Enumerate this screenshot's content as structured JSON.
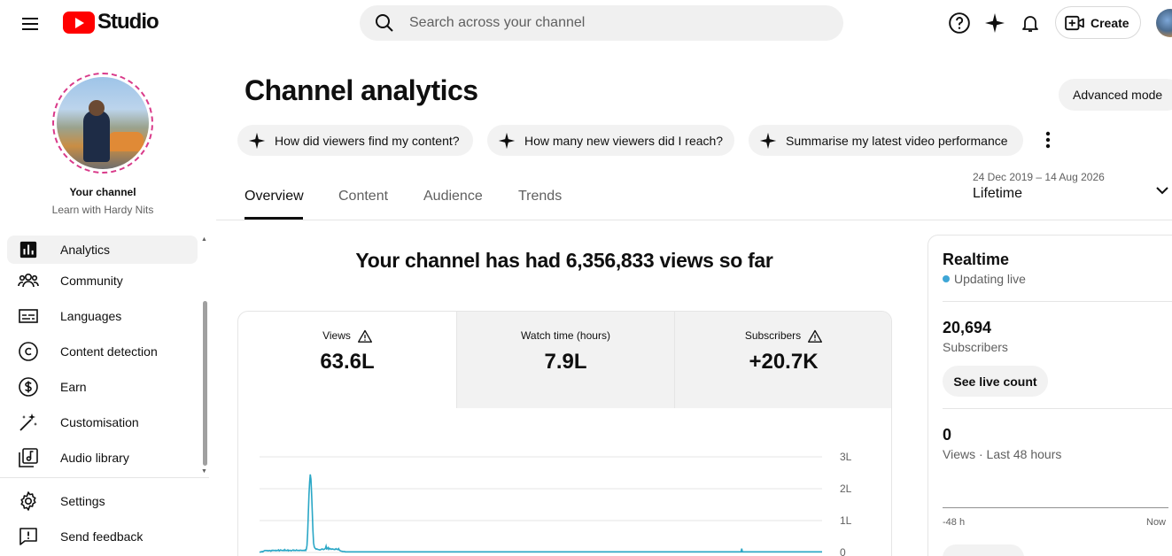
{
  "header": {
    "logo_text": "Studio",
    "search_placeholder": "Search across your channel",
    "create_label": "Create"
  },
  "sidebar": {
    "your_channel": "Your channel",
    "channel_name": "Learn with Hardy Nits",
    "items": [
      {
        "label": "Analytics",
        "icon": "analytics-icon",
        "active": true
      },
      {
        "label": "Community",
        "icon": "community-icon"
      },
      {
        "label": "Languages",
        "icon": "subtitles-icon"
      },
      {
        "label": "Content detection",
        "icon": "copyright-icon"
      },
      {
        "label": "Earn",
        "icon": "dollar-icon"
      },
      {
        "label": "Customisation",
        "icon": "magic-wand-icon"
      },
      {
        "label": "Audio library",
        "icon": "audio-library-icon"
      }
    ],
    "footer_items": [
      {
        "label": "Settings",
        "icon": "gear-icon"
      },
      {
        "label": "Send feedback",
        "icon": "feedback-icon"
      }
    ]
  },
  "main": {
    "title": "Channel analytics",
    "advanced_mode": "Advanced mode",
    "chips": [
      "How did viewers find my content?",
      "How many new viewers did I reach?",
      "Summarise my latest video performance"
    ],
    "tabs": [
      "Overview",
      "Content",
      "Audience",
      "Trends"
    ],
    "active_tab": "Overview",
    "date_range": "24 Dec 2019 – 14 Aug 2026",
    "date_label": "Lifetime",
    "headline": "Your channel has had 6,356,833 views so far",
    "metrics": [
      {
        "label": "Views",
        "value": "63.6L",
        "warning": true
      },
      {
        "label": "Watch time (hours)",
        "value": "7.9L",
        "warning": false
      },
      {
        "label": "Subscribers",
        "value": "+20.7K",
        "warning": true
      }
    ]
  },
  "chart_data": {
    "type": "line",
    "series": [
      {
        "values": [
          0.02,
          0.01,
          0.02,
          0.02,
          0.03,
          0.02,
          0.04,
          0.05,
          0.06,
          0.06,
          0.06,
          0.06,
          0.05,
          0.06,
          0.05,
          0.06,
          0.06,
          0.04,
          0.05,
          0.07,
          0.06,
          0.07,
          0.06,
          0.06,
          0.07,
          0.05,
          0.06,
          0.07,
          0.06,
          0.08,
          0.05,
          0.06,
          0.08,
          0.07,
          0.06,
          0.06,
          0.07,
          0.06,
          0.09,
          0.06,
          0.07,
          0.06,
          0.06,
          0.08,
          0.05,
          0.06,
          0.07,
          0.06,
          0.05,
          0.06,
          0.07,
          0.08,
          0.06,
          0.07,
          0.06,
          0.06,
          0.08,
          0.07,
          0.06,
          0.06,
          0.07,
          0.06,
          0.07,
          0.07,
          0.06,
          0.06,
          0.07,
          0.06,
          0.06,
          0.08,
          0.06,
          0.1,
          0.22,
          0.6,
          1.2,
          1.8,
          2.2,
          2.45,
          2.3,
          1.85,
          1.3,
          0.7,
          0.3,
          0.18,
          0.14,
          0.12,
          0.1,
          0.11,
          0.1,
          0.09,
          0.09,
          0.08,
          0.08,
          0.09,
          0.1,
          0.11,
          0.1,
          0.09,
          0.1,
          0.11,
          0.13,
          0.2,
          0.11,
          0.12,
          0.15,
          0.1,
          0.13,
          0.12,
          0.1,
          0.11,
          0.1,
          0.11,
          0.1,
          0.1,
          0.09,
          0.1,
          0.12,
          0.1,
          0.1,
          0.09,
          0.12,
          0.08,
          0.06,
          0.05,
          0.04,
          0.04,
          0.03,
          0.03,
          0.03,
          0.03,
          0.02,
          0.02,
          0.02,
          0.02,
          0.02,
          0.02,
          0.02,
          0.02,
          0.02,
          0.02,
          0.02,
          0.02,
          0.02,
          0.02,
          0.02,
          0.02,
          0.02,
          0.02,
          0.02,
          0.02,
          0.02,
          0.02,
          0.02,
          0.02,
          0.02,
          0.02,
          0.02,
          0.02,
          0.02,
          0.02,
          0.02,
          0.02,
          0.02,
          0.02,
          0.02,
          0.02,
          0.02,
          0.02,
          0.02,
          0.02,
          0.02,
          0.02,
          0.02,
          0.02,
          0.02,
          0.02,
          0.02,
          0.02,
          0.02,
          0.02,
          0.02,
          0.02,
          0.02,
          0.02,
          0.02,
          0.02,
          0.02,
          0.02,
          0.02,
          0.02,
          0.02,
          0.02,
          0.02,
          0.02,
          0.02,
          0.02,
          0.02,
          0.02,
          0.02,
          0.02,
          0.02,
          0.02,
          0.02,
          0.02,
          0.02,
          0.02,
          0.02,
          0.02,
          0.02,
          0.02,
          0.02,
          0.02,
          0.02,
          0.02,
          0.02,
          0.02,
          0.02,
          0.02,
          0.02,
          0.02,
          0.02,
          0.02,
          0.02,
          0.02,
          0.02,
          0.02,
          0.02,
          0.02,
          0.02,
          0.02,
          0.02,
          0.02,
          0.02,
          0.02,
          0.02,
          0.02,
          0.02,
          0.02,
          0.02,
          0.02,
          0.02,
          0.02,
          0.02,
          0.02,
          0.02,
          0.02,
          0.02,
          0.02,
          0.02,
          0.02,
          0.02,
          0.02,
          0.02,
          0.02,
          0.02,
          0.02,
          0.02,
          0.02,
          0.02,
          0.02,
          0.02,
          0.02,
          0.02,
          0.02,
          0.02,
          0.02,
          0.02,
          0.02,
          0.02,
          0.02,
          0.02,
          0.02,
          0.02,
          0.02,
          0.02,
          0.02,
          0.02,
          0.02,
          0.02,
          0.02,
          0.02,
          0.02,
          0.02,
          0.02,
          0.02,
          0.02,
          0.02,
          0.02,
          0.02,
          0.02,
          0.02,
          0.02,
          0.02,
          0.02,
          0.02,
          0.02,
          0.02,
          0.02,
          0.02,
          0.02,
          0.02,
          0.02,
          0.02,
          0.02,
          0.02,
          0.02,
          0.02,
          0.02,
          0.02,
          0.02,
          0.02,
          0.02,
          0.02,
          0.02,
          0.02,
          0.02,
          0.02,
          0.02,
          0.02,
          0.02,
          0.02,
          0.02,
          0.02,
          0.02,
          0.02,
          0.02,
          0.02,
          0.02,
          0.02,
          0.02,
          0.02,
          0.02,
          0.02,
          0.02,
          0.02,
          0.02,
          0.02,
          0.02,
          0.02,
          0.02,
          0.02,
          0.02,
          0.02,
          0.02,
          0.02,
          0.02,
          0.02,
          0.02,
          0.02,
          0.02,
          0.02,
          0.02,
          0.02,
          0.02,
          0.02,
          0.02,
          0.02,
          0.02,
          0.02,
          0.02,
          0.02,
          0.02,
          0.02,
          0.02,
          0.02,
          0.02,
          0.02,
          0.02,
          0.02,
          0.02,
          0.02,
          0.02,
          0.02,
          0.02,
          0.02,
          0.02,
          0.02,
          0.02,
          0.02,
          0.02,
          0.02,
          0.02,
          0.02,
          0.02,
          0.02,
          0.02,
          0.02,
          0.02,
          0.02,
          0.02,
          0.02,
          0.02,
          0.02,
          0.02,
          0.02,
          0.02,
          0.02,
          0.02,
          0.02,
          0.02,
          0.02,
          0.02,
          0.02,
          0.02,
          0.02,
          0.02,
          0.02,
          0.02,
          0.02,
          0.02,
          0.02,
          0.02,
          0.02,
          0.02,
          0.02,
          0.02,
          0.02,
          0.02,
          0.02,
          0.02,
          0.02,
          0.02,
          0.02,
          0.02,
          0.02,
          0.02,
          0.02,
          0.02,
          0.02,
          0.02,
          0.02,
          0.02,
          0.02,
          0.02,
          0.02,
          0.02,
          0.02,
          0.02,
          0.02,
          0.02,
          0.02,
          0.02,
          0.02,
          0.02,
          0.02,
          0.02,
          0.02,
          0.02,
          0.02,
          0.02,
          0.02,
          0.02,
          0.02,
          0.02,
          0.02,
          0.02,
          0.02,
          0.02,
          0.02,
          0.02,
          0.02,
          0.02,
          0.02,
          0.02,
          0.02,
          0.02,
          0.02,
          0.02,
          0.02,
          0.02,
          0.02,
          0.02,
          0.02,
          0.02,
          0.02,
          0.02,
          0.02,
          0.02,
          0.02,
          0.02,
          0.02,
          0.02,
          0.02,
          0.02,
          0.02,
          0.02,
          0.02,
          0.02,
          0.02,
          0.02,
          0.02,
          0.02,
          0.02,
          0.02,
          0.02,
          0.02,
          0.02,
          0.02,
          0.02,
          0.02,
          0.02,
          0.02,
          0.02,
          0.02,
          0.02,
          0.02,
          0.02,
          0.02,
          0.02,
          0.02,
          0.02,
          0.02,
          0.02,
          0.02,
          0.02,
          0.02,
          0.02,
          0.02,
          0.02,
          0.02,
          0.02,
          0.02,
          0.02,
          0.02,
          0.02,
          0.02,
          0.02,
          0.02,
          0.02,
          0.02,
          0.02,
          0.02,
          0.02,
          0.02,
          0.02,
          0.02,
          0.02,
          0.02,
          0.02,
          0.02,
          0.02,
          0.02,
          0.02,
          0.02,
          0.02,
          0.02,
          0.02,
          0.02,
          0.02,
          0.02,
          0.02,
          0.02,
          0.02,
          0.02,
          0.02,
          0.02,
          0.02,
          0.02,
          0.02,
          0.02,
          0.02,
          0.02,
          0.02,
          0.02,
          0.02,
          0.02,
          0.02,
          0.02,
          0.02,
          0.02,
          0.02,
          0.02,
          0.02,
          0.02,
          0.02,
          0.02,
          0.02,
          0.02,
          0.02,
          0.02,
          0.02,
          0.02,
          0.02,
          0.02,
          0.02,
          0.02,
          0.02,
          0.02,
          0.02,
          0.02,
          0.02,
          0.02,
          0.02,
          0.02,
          0.02,
          0.02,
          0.02,
          0.02,
          0.02,
          0.02,
          0.02,
          0.02,
          0.02,
          0.02,
          0.02,
          0.02,
          0.02,
          0.02,
          0.02,
          0.02,
          0.02,
          0.02,
          0.02,
          0.02,
          0.02,
          0.02,
          0.02,
          0.02,
          0.02,
          0.02,
          0.02,
          0.02,
          0.02,
          0.02,
          0.02,
          0.02,
          0.02,
          0.02,
          0.02,
          0.02,
          0.02,
          0.02,
          0.02,
          0.02,
          0.02,
          0.02,
          0.02,
          0.02,
          0.02,
          0.02,
          0.02,
          0.02,
          0.02,
          0.02,
          0.02,
          0.02,
          0.02,
          0.02,
          0.02,
          0.02,
          0.02,
          0.02,
          0.02,
          0.02,
          0.02,
          0.02,
          0.02,
          0.02,
          0.02,
          0.02,
          0.02,
          0.02,
          0.02,
          0.02,
          0.02,
          0.02,
          0.02,
          0.02,
          0.02,
          0.02,
          0.02,
          0.02,
          0.02,
          0.02,
          0.02,
          0.02,
          0.02,
          0.02,
          0.02,
          0.02,
          0.02,
          0.02,
          0.02,
          0.02,
          0.02,
          0.02,
          0.02,
          0.02,
          0.02,
          0.02,
          0.02,
          0.02,
          0.02,
          0.02,
          0.02,
          0.02,
          0.02,
          0.02,
          0.02,
          0.02,
          0.02,
          0.02,
          0.02,
          0.02,
          0.02,
          0.02,
          0.02,
          0.02,
          0.02,
          0.02,
          0.02,
          0.02,
          0.02,
          0.02,
          0.02,
          0.02,
          0.02,
          0.02,
          0.02,
          0.02,
          0.02,
          0.02,
          0.02,
          0.02,
          0.02,
          0.02,
          0.02,
          0.02,
          0.02,
          0.02,
          0.02,
          0.02,
          0.12,
          0.02,
          0.02,
          0.02,
          0.02,
          0.02,
          0.02,
          0.02,
          0.02,
          0.02,
          0.02,
          0.02,
          0.02,
          0.02,
          0.02,
          0.02,
          0.02,
          0.02,
          0.02,
          0.02,
          0.02,
          0.02,
          0.02,
          0.02,
          0.02,
          0.02,
          0.02,
          0.02,
          0.02,
          0.02,
          0.02,
          0.02,
          0.02,
          0.02,
          0.02,
          0.02,
          0.02,
          0.02,
          0.02,
          0.02,
          0.02,
          0.02,
          0.02,
          0.02,
          0.02,
          0.02,
          0.02,
          0.02,
          0.02,
          0.02,
          0.02,
          0.02,
          0.02,
          0.02,
          0.02,
          0.02,
          0.02,
          0.02,
          0.02,
          0.02,
          0.02,
          0.02,
          0.02,
          0.02,
          0.02,
          0.02,
          0.02,
          0.02,
          0.02,
          0.02,
          0.02,
          0.02,
          0.02,
          0.02,
          0.02,
          0.02,
          0.02,
          0.02,
          0.02,
          0.02,
          0.02,
          0.02,
          0.02,
          0.02,
          0.02,
          0.02,
          0.02,
          0.02,
          0.02,
          0.02,
          0.02,
          0.02,
          0.02,
          0.02,
          0.02,
          0.02,
          0.02,
          0.02,
          0.02,
          0.02,
          0.02,
          0.02,
          0.02,
          0.02,
          0.02,
          0.02,
          0.02,
          0.02,
          0.02,
          0.02,
          0.02,
          0.02,
          0.02,
          0.02,
          0.02,
          0.02,
          0.02,
          0.02,
          0.02,
          0.02,
          0.02,
          0.02,
          0.02
        ]
      }
    ],
    "yticks": [
      "3L",
      "2L",
      "1L",
      "0"
    ],
    "ylim": [
      0,
      3
    ],
    "grid": true,
    "color": "#2aa7c6"
  },
  "realtime": {
    "title": "Realtime",
    "status": "Updating live",
    "subscribers_value": "20,694",
    "subscribers_label": "Subscribers",
    "see_live_count": "See live count",
    "views_value": "0",
    "views_label": "Views · Last 48 hours",
    "axis_start": "-48 h",
    "axis_end": "Now"
  },
  "colors": {
    "brand_red": "#ff0000",
    "chip_bg": "#f2f2f2",
    "live_dot": "#3ea6d6",
    "line": "#2aa7c6"
  }
}
